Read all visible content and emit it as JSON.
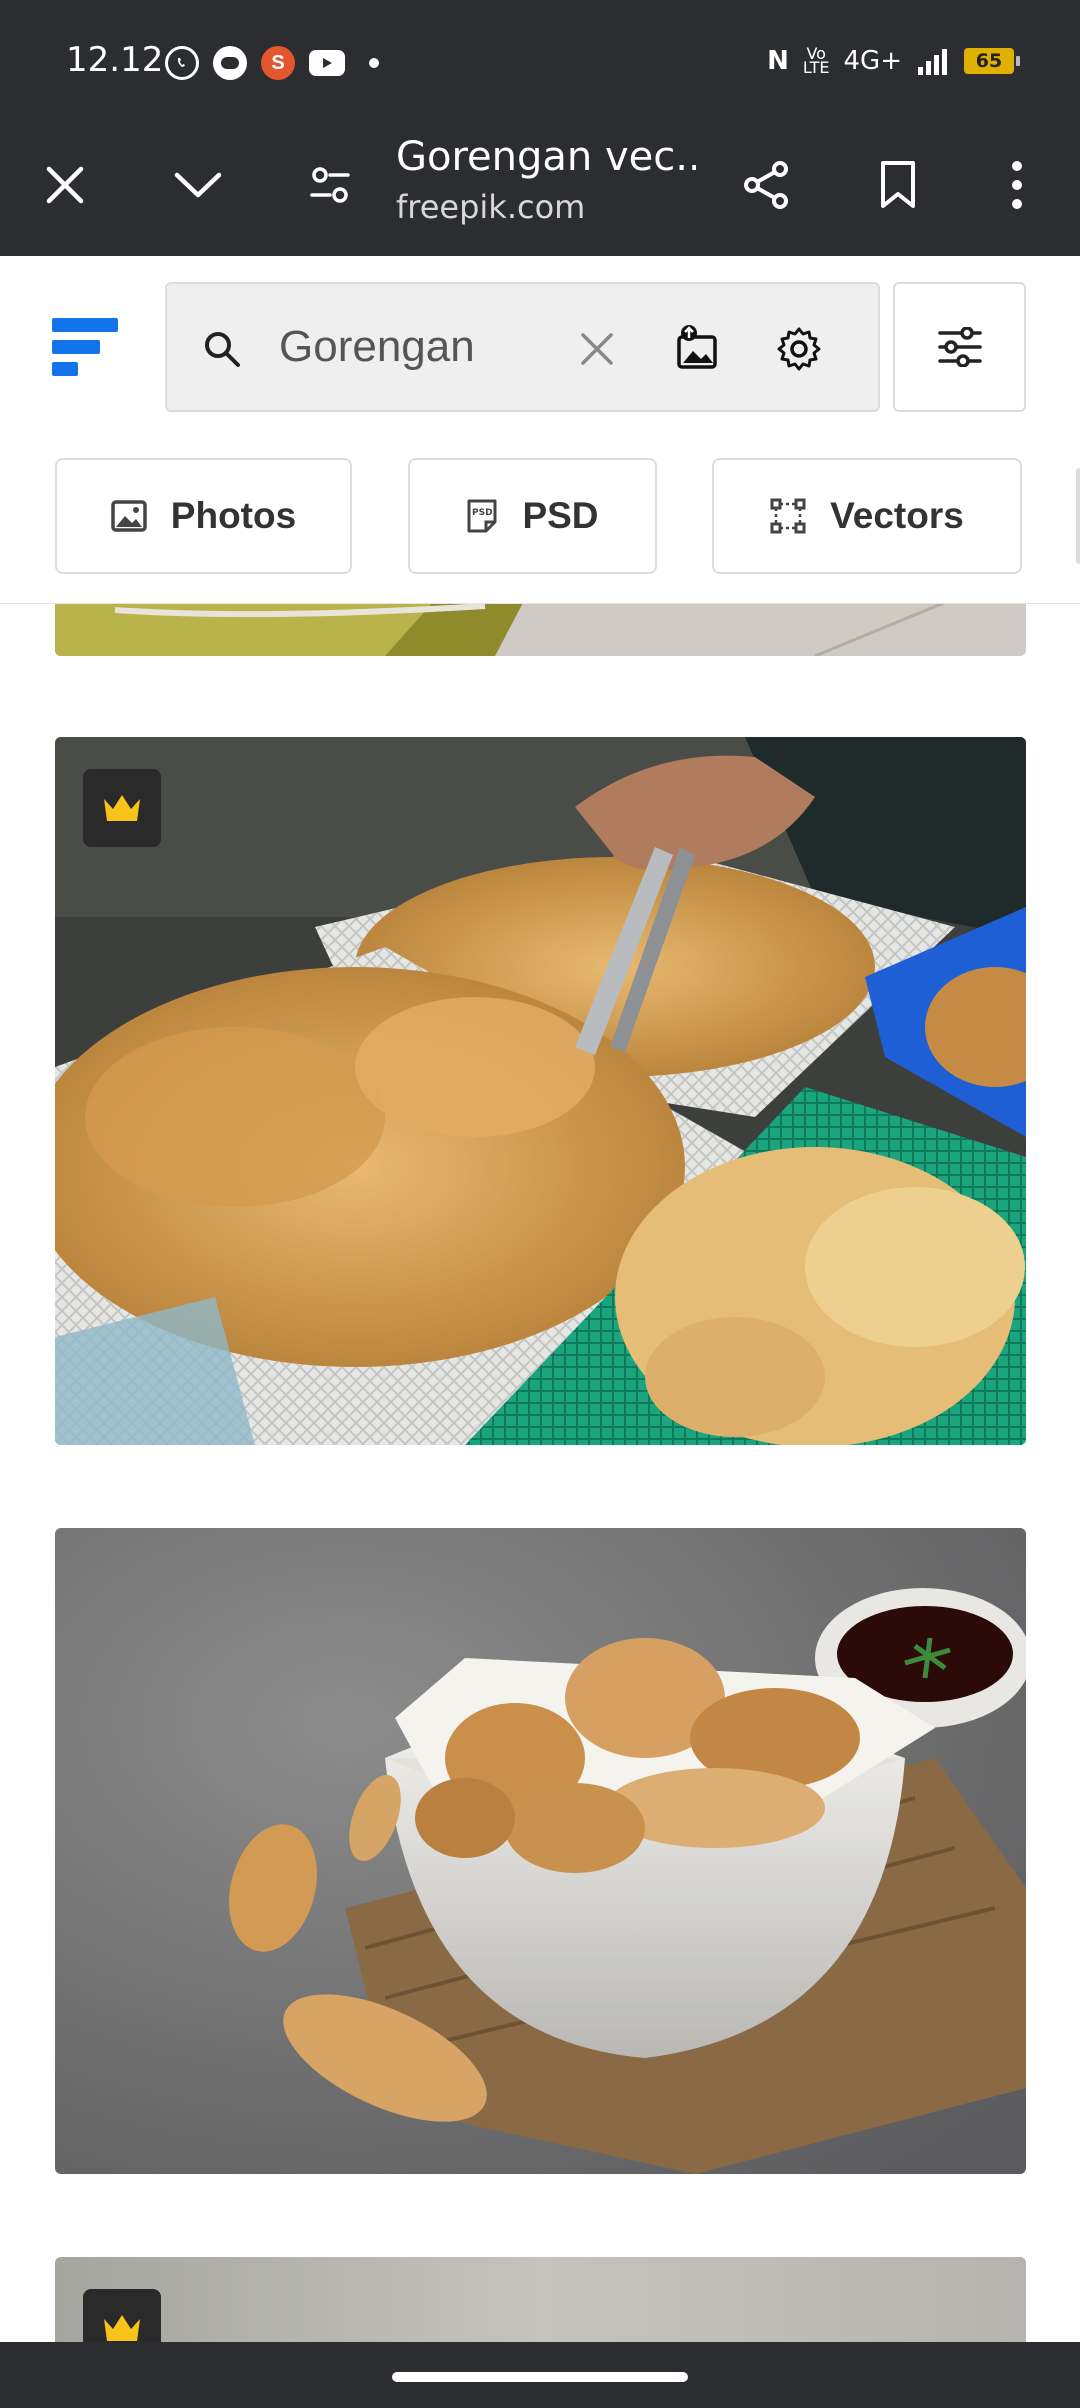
{
  "status_bar": {
    "time": "12.12",
    "network": "4G+",
    "battery": "65",
    "app_icons": [
      "whatsapp-icon",
      "chat-icon",
      "app-s-icon",
      "youtube-icon",
      "dot-icon"
    ]
  },
  "browser_toolbar": {
    "page_title": "Gorengan vec...",
    "domain": "freepik.com"
  },
  "search": {
    "query": "Gorengan"
  },
  "filters": {
    "chips": [
      {
        "label": "Photos",
        "icon": "image-icon"
      },
      {
        "label": "PSD",
        "icon": "psd-file-icon"
      },
      {
        "label": "Vectors",
        "icon": "vector-icon"
      }
    ]
  },
  "results": [
    {
      "description": "partial photo",
      "premium": false
    },
    {
      "description": "fried snacks in baskets with tongs",
      "premium": true
    },
    {
      "description": "fried tofu dumplings in white bowl with sauce",
      "premium": false
    },
    {
      "description": "partial photo",
      "premium": true
    }
  ],
  "colors": {
    "chrome": "#2b2d31",
    "brand_blue": "#1273eb",
    "crown": "#f7c31a"
  }
}
